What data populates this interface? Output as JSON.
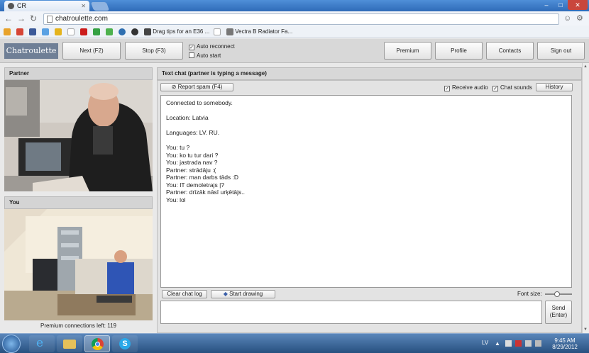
{
  "browser": {
    "tab_title": "CR",
    "url": "chatroulette.com",
    "bookmarks": [
      {
        "label": "Drag tips for an E36 ...",
        "icon": "car-icon"
      },
      {
        "label": "Vectra B Radiator Fa...",
        "icon": "car-icon"
      }
    ]
  },
  "header": {
    "logo": "Chatroulette",
    "next": "Next (F2)",
    "stop": "Stop (F3)",
    "auto_reconnect": "Auto reconnect",
    "auto_start": "Auto start",
    "premium": "Premium",
    "profile": "Profile",
    "contacts": "Contacts",
    "signout": "Sign out"
  },
  "partner": {
    "title": "Partner"
  },
  "you": {
    "title": "You",
    "premium_left": "Premium connections left: 119"
  },
  "chat": {
    "title": "Text chat (partner is typing a message)",
    "report_spam": "Report spam (F4)",
    "receive_audio": "Receive audio",
    "chat_sounds": "Chat sounds",
    "history": "History",
    "messages": [
      "Connected to somebody.",
      "",
      "Location: Latvia",
      "",
      "Languages: LV. RU.",
      "",
      "You: tu ?",
      "You: ko tu tur dari ?",
      "You: jastrada nav ?",
      "Partner: strādāju :(",
      "Partner: man darbs tāds :D",
      "You: IT demoletrajs |?",
      "Partner: drīzāk nāsī urķētājs..",
      "You: lol"
    ],
    "clear_log": "Clear chat log",
    "start_drawing": "Start drawing",
    "font_size": "Font size:",
    "send": "Send",
    "send_hint": "(Enter)"
  },
  "taskbar": {
    "lang": "LV",
    "time": "9:45 AM",
    "date": "8/29/2012"
  },
  "colors": {
    "taskbar": "#2f5a8c",
    "logo_bg": "#6f7f96",
    "titlebar": "#3f7dc8"
  }
}
